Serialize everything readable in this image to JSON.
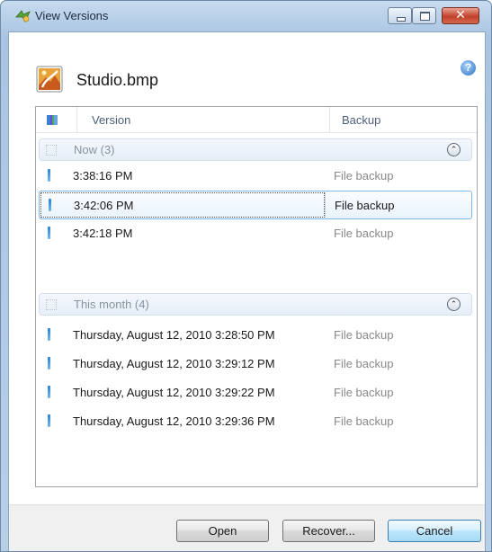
{
  "window": {
    "title": "View Versions",
    "close_glyph": "✕"
  },
  "file": {
    "name": "Studio.bmp",
    "icon": "bitmap-file-icon"
  },
  "help": {
    "icon": "help-icon",
    "glyph": "?"
  },
  "columns": {
    "version": "Version",
    "backup": "Backup"
  },
  "groups": [
    {
      "title": "Now (3)",
      "toggle_glyph": "⌃",
      "rows": [
        {
          "version": "3:38:16 PM",
          "backup": "File backup"
        },
        {
          "version": "3:42:06 PM",
          "backup": "File backup",
          "selected": true
        },
        {
          "version": "3:42:18 PM",
          "backup": "File backup"
        }
      ]
    },
    {
      "title": "This month (4)",
      "toggle_glyph": "⌃",
      "rows": [
        {
          "version": "Thursday, August 12, 2010 3:28:50 PM",
          "backup": "File backup"
        },
        {
          "version": "Thursday, August 12, 2010 3:29:12 PM",
          "backup": "File backup"
        },
        {
          "version": "Thursday, August 12, 2010 3:29:22 PM",
          "backup": "File backup"
        },
        {
          "version": "Thursday, August 12, 2010 3:29:36 PM",
          "backup": "File backup"
        }
      ]
    }
  ],
  "buttons": {
    "open": "Open",
    "recover": "Recover...",
    "cancel": "Cancel"
  },
  "colors": {
    "title_bar": "#b8cfe8",
    "selection_border": "#7fbbe6",
    "close_button": "#c2402a",
    "default_button": "#bee6fd"
  }
}
